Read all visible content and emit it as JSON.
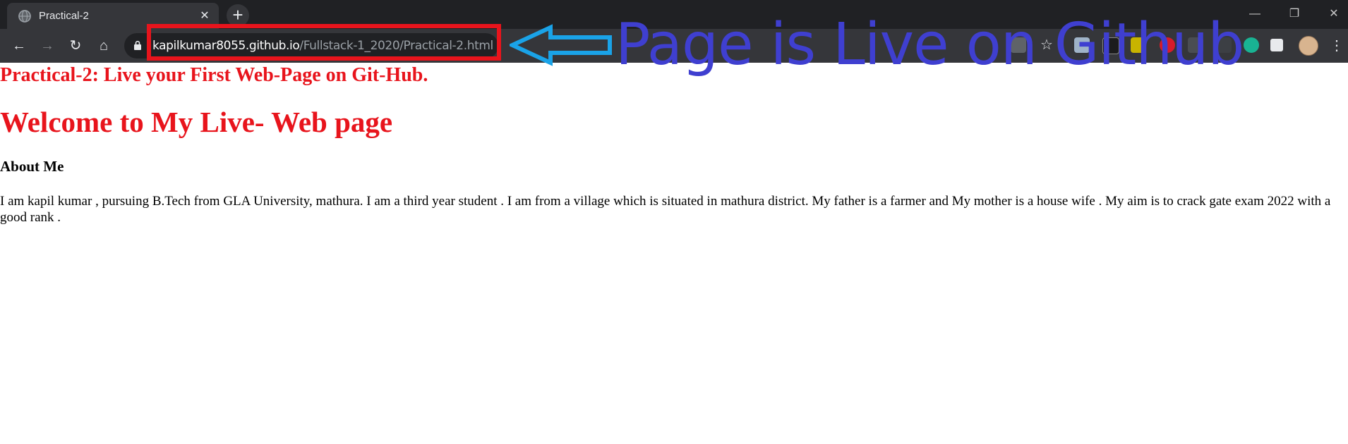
{
  "browser": {
    "tab": {
      "title": "Practical-2",
      "close_glyph": "✕"
    },
    "new_tab_glyph": "+",
    "window_controls": {
      "minimize": "—",
      "restore": "❐",
      "close": "✕"
    },
    "nav": {
      "back": "←",
      "forward": "→",
      "reload": "↻",
      "home": "⌂"
    },
    "address": {
      "host": "kapilkumar8055.github.io",
      "path": "/Fullstack-1_2020/Practical-2.html"
    },
    "extensions": [
      "translate-icon",
      "star-icon",
      "extension-icon",
      "extension-icon",
      "extension-icon",
      "extension-icon",
      "extension-icon",
      "extension-icon",
      "extension-icon",
      "puzzle-icon"
    ],
    "bookmark_glyph": "☆",
    "menu_glyph": "⋮"
  },
  "annotation": {
    "text": "Page is Live on Github",
    "color": "#3f3fd0",
    "arrow_color": "#1aa3e8",
    "box_color": "#e8141c"
  },
  "page": {
    "practical_heading": "Practical-2: Live your First Web-Page on Git-Hub.",
    "welcome_heading": "Welcome to My Live- Web page",
    "about_heading": "About Me",
    "about_text": "I am kapil kumar , pursuing B.Tech from GLA University, mathura. I am a third year student . I am from a village which is situated in mathura district. My father is a farmer and My mother is a house wife . My aim is to crack gate exam 2022 with a good rank ."
  }
}
